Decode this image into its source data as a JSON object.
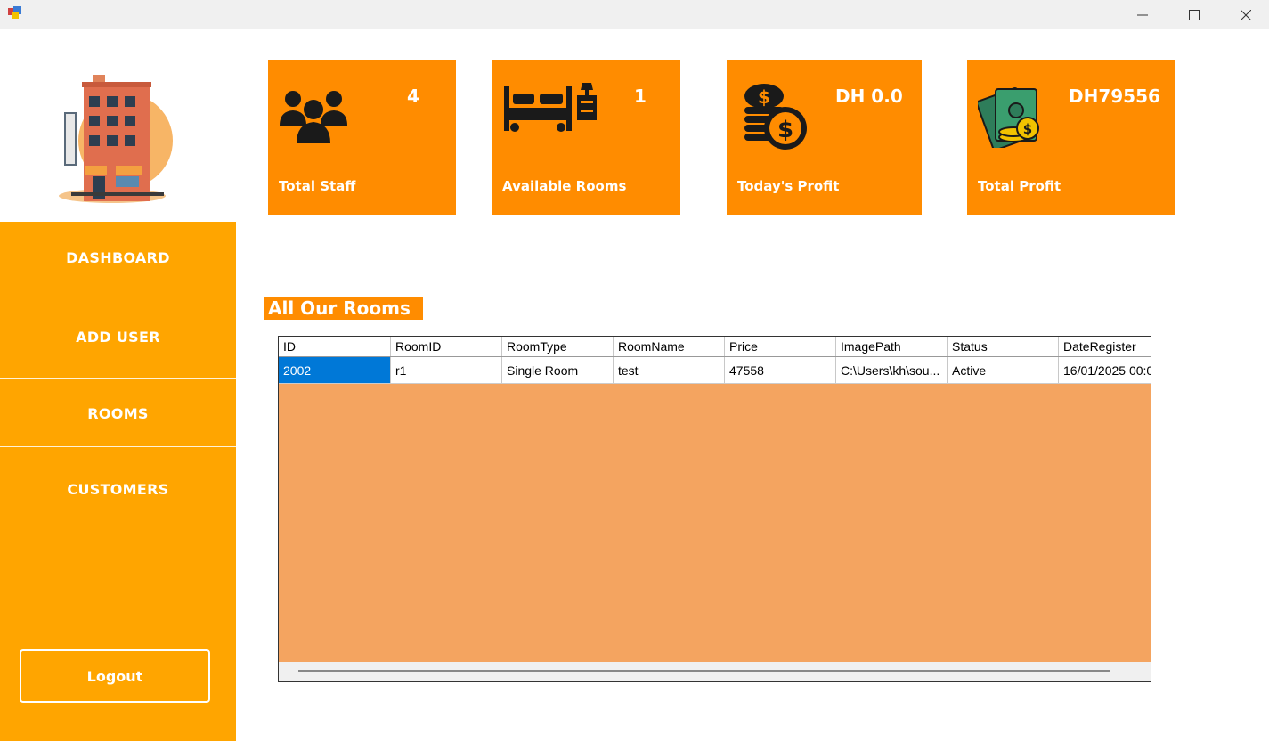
{
  "window": {
    "minimize_glyph": "—",
    "maximize_glyph": "☐",
    "close_glyph": "✕"
  },
  "sidebar": {
    "items": [
      {
        "label": "DASHBOARD"
      },
      {
        "label": "ADD USER"
      },
      {
        "label": "ROOMS"
      },
      {
        "label": "CUSTOMERS"
      }
    ],
    "logout_label": "Logout"
  },
  "cards": [
    {
      "label": "Total Staff",
      "value": "4",
      "icon": "users-icon"
    },
    {
      "label": "Available Rooms",
      "value": "1",
      "icon": "bed-icon"
    },
    {
      "label": "Today's Profit",
      "value": "DH 0.0",
      "icon": "coins-icon"
    },
    {
      "label": "Total Profit",
      "value": "DH79556",
      "icon": "money-icon"
    }
  ],
  "rooms": {
    "title": "All Our Rooms",
    "columns": [
      "ID",
      "RoomID",
      "RoomType",
      "RoomName",
      "Price",
      "ImagePath",
      "Status",
      "DateRegister"
    ],
    "rows": [
      [
        "2002",
        "r1",
        "Single Room",
        "test",
        "47558",
        "C:\\Users\\kh\\sou...",
        "Active",
        "16/01/2025 00:0"
      ]
    ]
  },
  "colors": {
    "sidebar": "#ffa500",
    "card": "#ff8c00",
    "grid_background": "#f4a460",
    "selection": "#0078d7"
  }
}
